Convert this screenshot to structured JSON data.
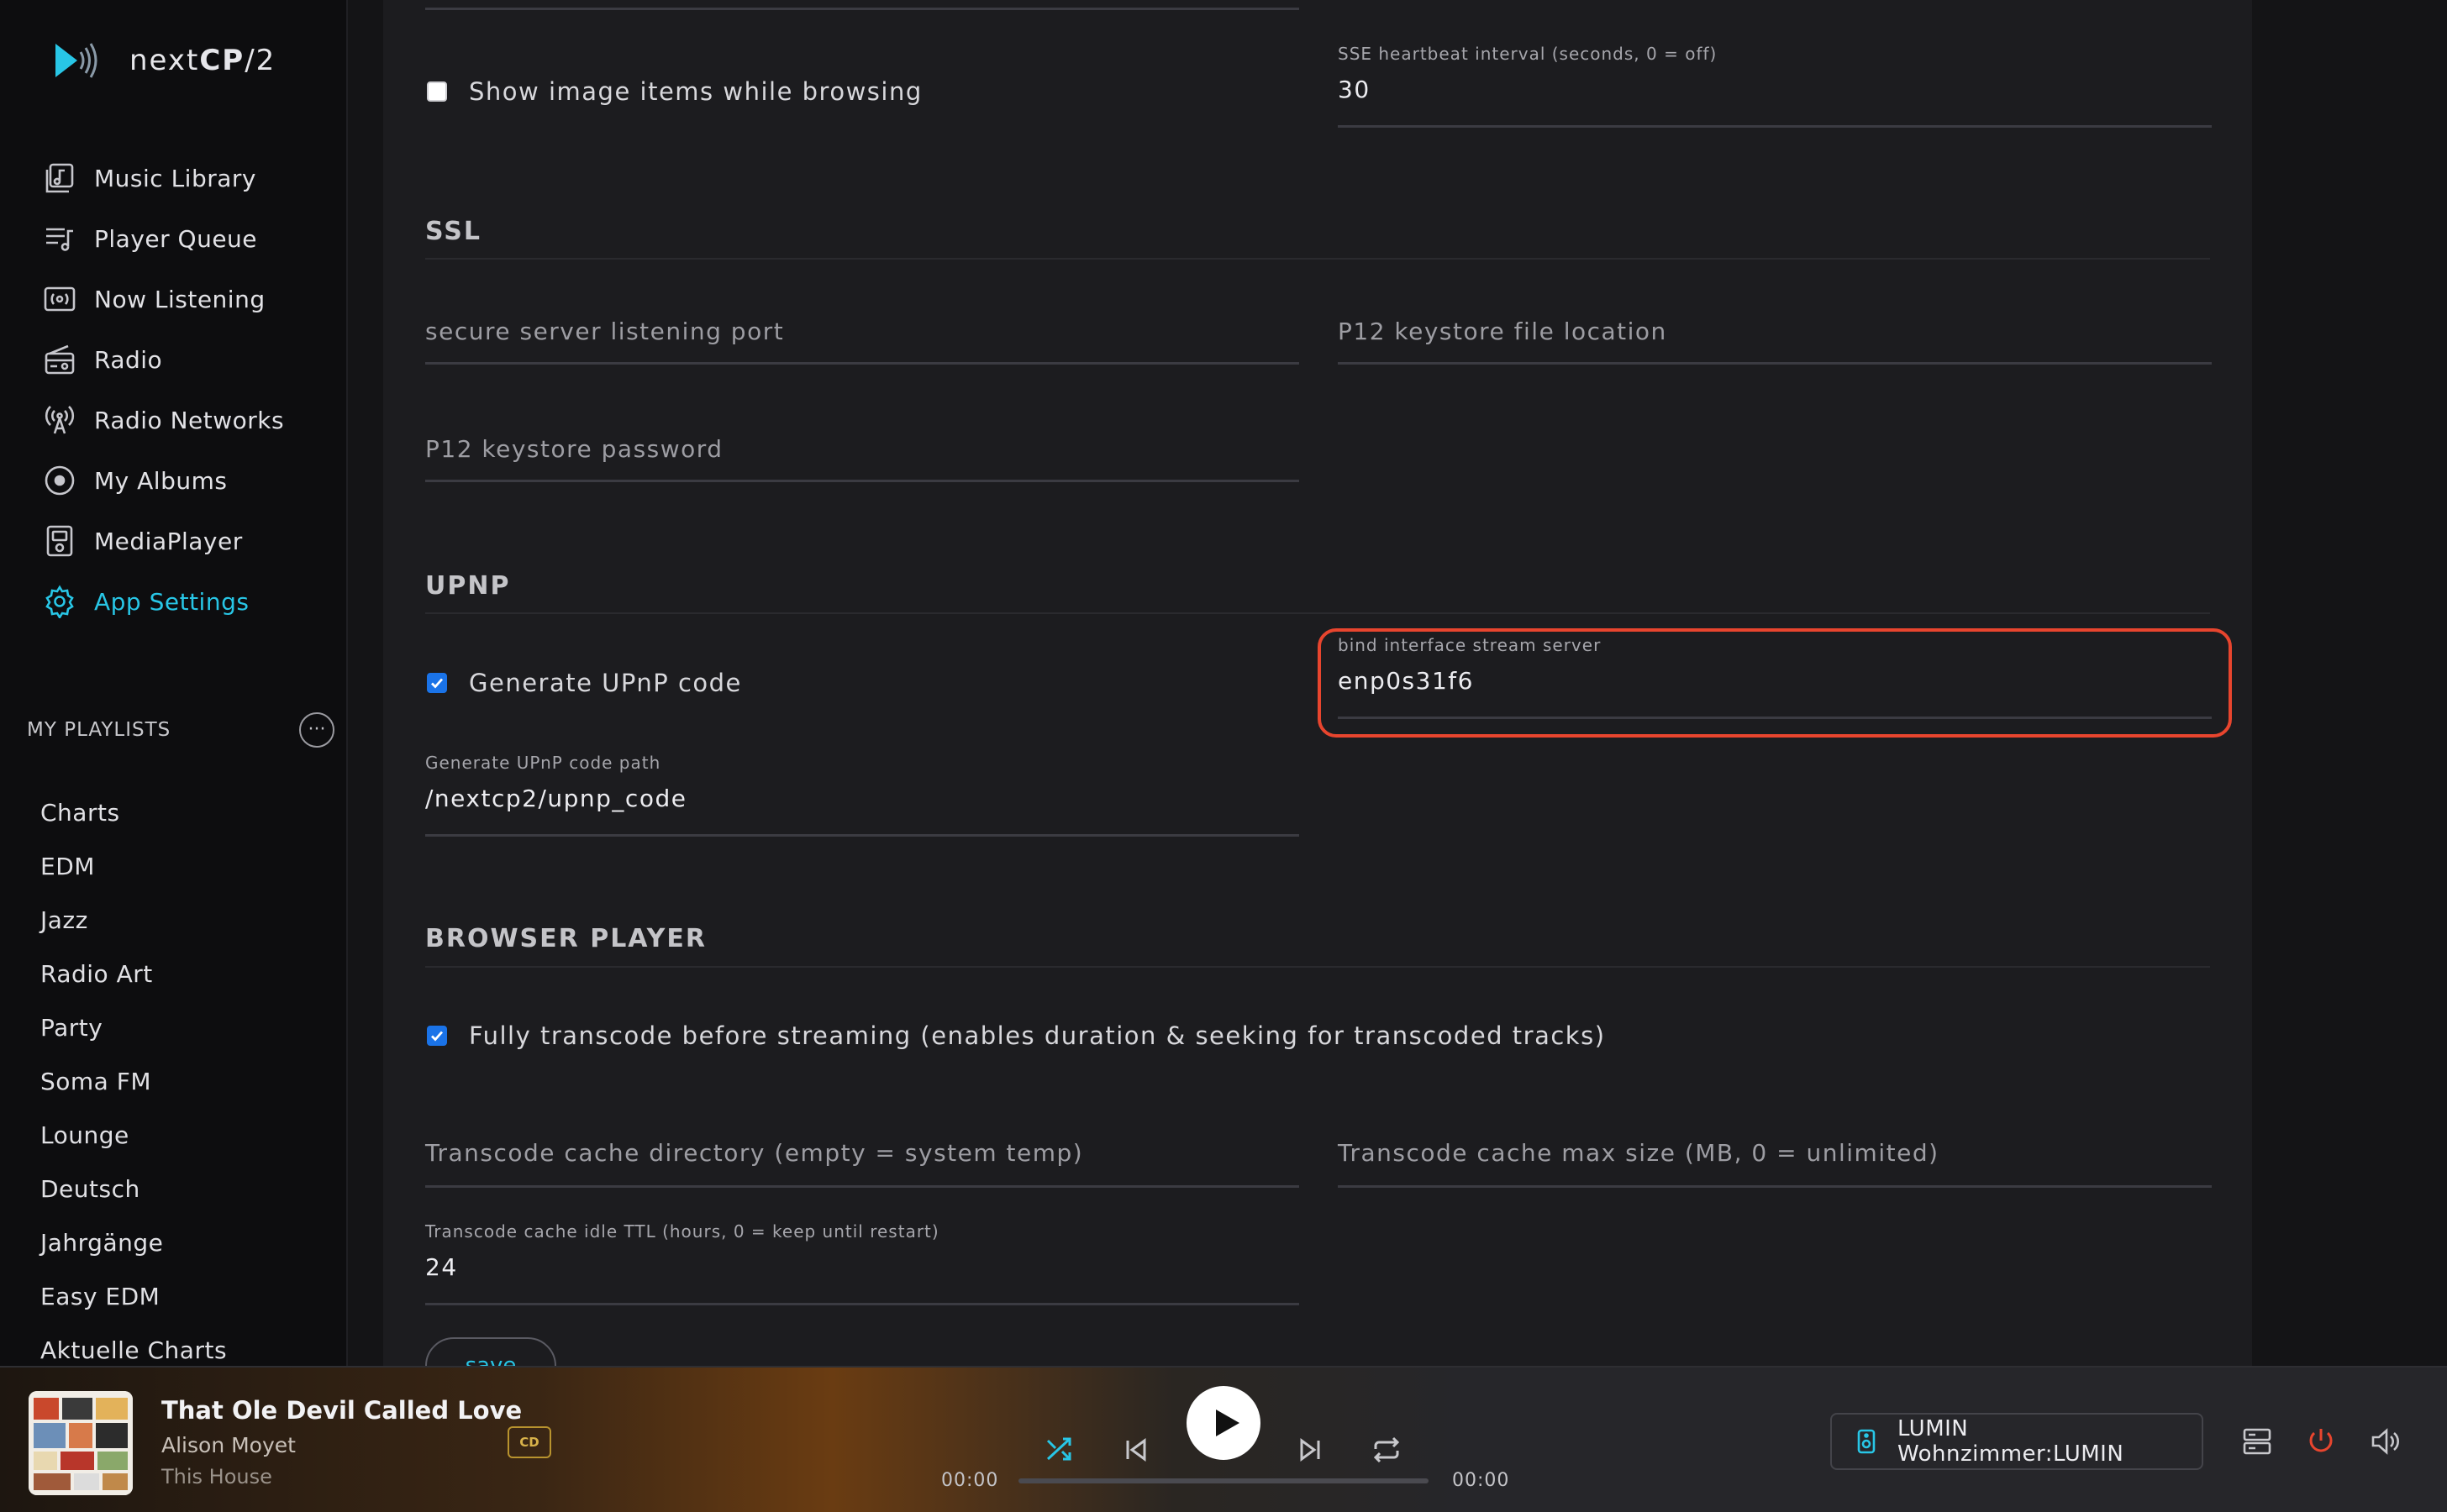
{
  "app": {
    "logo_prefix": "next",
    "logo_bold": "CP",
    "logo_suffix": "/2"
  },
  "nav": [
    {
      "label": "Music Library",
      "icon": "music-library-icon"
    },
    {
      "label": "Player Queue",
      "icon": "queue-icon"
    },
    {
      "label": "Now Listening",
      "icon": "now-listening-icon"
    },
    {
      "label": "Radio",
      "icon": "radio-icon"
    },
    {
      "label": "Radio Networks",
      "icon": "antenna-icon"
    },
    {
      "label": "My Albums",
      "icon": "album-icon"
    },
    {
      "label": "MediaPlayer",
      "icon": "media-player-icon"
    },
    {
      "label": "App Settings",
      "icon": "gear-icon",
      "active": true
    }
  ],
  "playlists": {
    "title": "MY PLAYLISTS",
    "items": [
      "Charts",
      "EDM",
      "Jazz",
      "Radio Art",
      "Party",
      "Soma FM",
      "Lounge",
      "Deutsch",
      "Jahrgänge",
      "Easy EDM",
      "Aktuelle Charts"
    ]
  },
  "settings": {
    "show_image_items": {
      "label": "Show image items while browsing",
      "checked": false
    },
    "sse_heartbeat": {
      "label": "SSE heartbeat interval (seconds, 0 = off)",
      "value": "30"
    },
    "ssl": {
      "title": "SSL",
      "secure_port_placeholder": "secure server listening port",
      "p12_location_placeholder": "P12 keystore file location",
      "p12_password_placeholder": "P12 keystore password"
    },
    "upnp": {
      "title": "UPNP",
      "generate_code": {
        "label": "Generate UPnP code",
        "checked": true
      },
      "bind_interface": {
        "label": "bind interface stream server",
        "value": "enp0s31f6"
      },
      "code_path": {
        "label": "Generate UPnP code path",
        "value": "/nextcp2/upnp_code"
      }
    },
    "browser_player": {
      "title": "BROWSER PLAYER",
      "full_transcode": {
        "label": "Fully transcode before streaming (enables duration & seeking for transcoded tracks)",
        "checked": true
      },
      "cache_dir_placeholder": "Transcode cache directory (empty = system temp)",
      "cache_max_placeholder": "Transcode cache max size (MB, 0 = unlimited)",
      "cache_ttl": {
        "label": "Transcode cache idle TTL (hours, 0 = keep until restart)",
        "value": "24"
      }
    },
    "save_label": "save"
  },
  "player": {
    "title": "That Ole Devil Called Love",
    "artist": "Alison Moyet",
    "album": "This House",
    "badge": "CD",
    "time_current": "00:00",
    "time_total": "00:00",
    "progress": 0,
    "renderer": "LUMIN Wohnzimmer:LUMIN",
    "accent": "#28c6e6",
    "power_color": "#e8452e"
  }
}
